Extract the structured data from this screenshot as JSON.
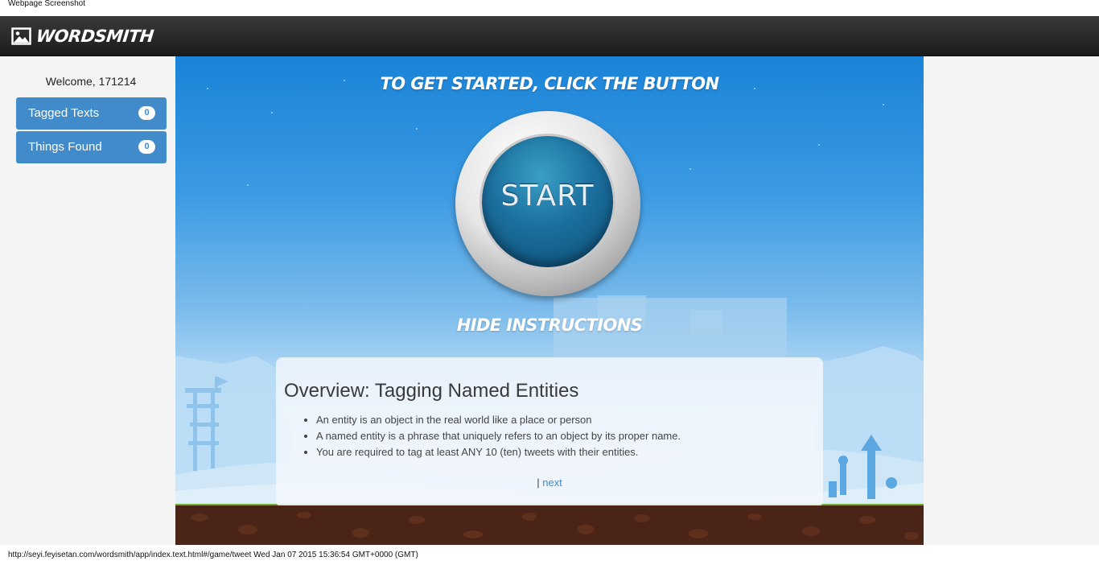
{
  "caption": "Webpage Screenshot",
  "brand": {
    "name": "Wordsmith",
    "icon": "image-icon"
  },
  "sidebar": {
    "welcome": "Welcome, 171214",
    "items": [
      {
        "label": "Tagged Texts",
        "count": "0"
      },
      {
        "label": "Things Found",
        "count": "0"
      }
    ]
  },
  "stage": {
    "headline": "To get started, click the button",
    "start_label": "START",
    "hide_label": "Hide instructions"
  },
  "instructions": {
    "title": "Overview: Tagging Named Entities",
    "bullets": [
      "An entity is an object in the real world like a place or person",
      "A named entity is a phrase that uniquely refers to an object by its proper name.",
      "You are required to tag at least ANY 10 (ten) tweets with their entities."
    ],
    "nav_separator": "|",
    "next_label": "next"
  },
  "status_bar": "http://seyi.feyisetan.com/wordsmith/app/index.text.html#/game/tweet Wed Jan 07 2015 15:36:54 GMT+0000 (GMT)",
  "colors": {
    "accent": "#428bca",
    "navbar": "#222222",
    "sky": "#1a84d8",
    "ground": "#4a2416"
  }
}
